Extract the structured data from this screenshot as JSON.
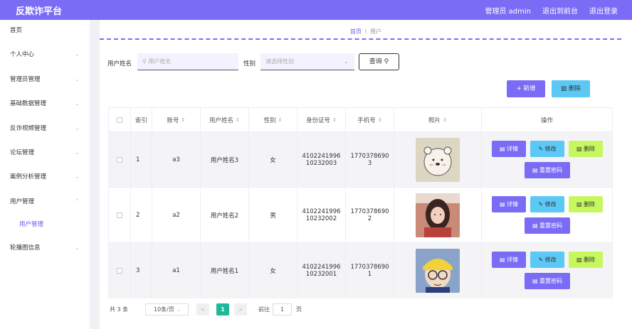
{
  "header": {
    "brand": "反欺诈平台",
    "admin": "管理员 admin",
    "frontend": "退出到前台",
    "logout": "退出登录"
  },
  "sidebar": {
    "items": [
      {
        "label": "首页",
        "chev": ""
      },
      {
        "label": "个人中心",
        "chev": "⌄"
      },
      {
        "label": "管理员管理",
        "chev": "⌄"
      },
      {
        "label": "基础数据管理",
        "chev": "⌄"
      },
      {
        "label": "反诈视频管理",
        "chev": "⌄"
      },
      {
        "label": "论坛管理",
        "chev": "⌄"
      },
      {
        "label": "案例分析管理",
        "chev": "⌄"
      },
      {
        "label": "用户管理",
        "chev": "⌃"
      },
      {
        "label": "用户管理"
      },
      {
        "label": "轮播图信息",
        "chev": "⌄"
      }
    ]
  },
  "breadcrumb": {
    "home": "首页",
    "sep": "⌇",
    "current": "用户"
  },
  "search": {
    "name_label": "用户姓名",
    "name_placeholder": "用户姓名",
    "gender_label": "性别",
    "gender_placeholder": "请选择性别",
    "query": "查询"
  },
  "actions": {
    "add": "新增",
    "delete": "删除"
  },
  "table": {
    "headers": [
      "",
      "索引",
      "账号",
      "用户姓名",
      "性别",
      "身份证号",
      "手机号",
      "照片",
      "操作"
    ],
    "rows": [
      {
        "index": "1",
        "account": "a3",
        "name": "用户姓名3",
        "gender": "女",
        "id1": "4102241996",
        "id2": "10232003",
        "ph1": "1770378690",
        "ph2": "3"
      },
      {
        "index": "2",
        "account": "a2",
        "name": "用户姓名2",
        "gender": "男",
        "id1": "4102241996",
        "id2": "10232002",
        "ph1": "1770378690",
        "ph2": "2"
      },
      {
        "index": "3",
        "account": "a1",
        "name": "用户姓名1",
        "gender": "女",
        "id1": "4102241996",
        "id2": "10232001",
        "ph1": "1770378690",
        "ph2": "1"
      }
    ],
    "ops": {
      "detail": "详情",
      "edit": "修改",
      "delete": "删除",
      "reset": "重置密码"
    }
  },
  "pagination": {
    "total": "共 3 条",
    "page_size": "10条/页",
    "prev": "<",
    "current": "1",
    "next": ">",
    "goto_label": "前往",
    "goto_value": "1",
    "page_suffix": "页"
  },
  "colors": {
    "accent": "#7b6cf6",
    "cyan": "#5bc8f5",
    "lime": "#c6f75e",
    "pager_active": "#1fb89a"
  }
}
